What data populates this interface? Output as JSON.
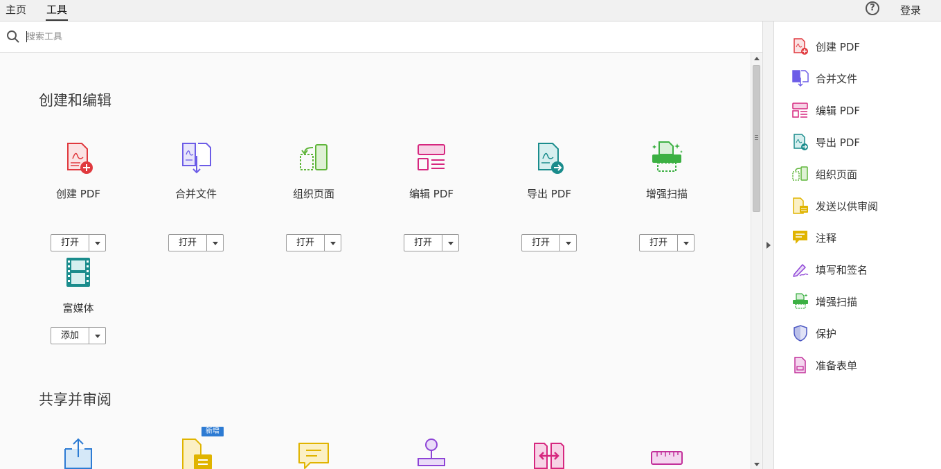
{
  "top_tabs": {
    "home": "主页",
    "tools": "工具"
  },
  "login": "登录",
  "help_icon_glyph": "?",
  "search": {
    "placeholder": "搜索工具"
  },
  "sections": {
    "create_edit": "创建和编辑",
    "share_review": "共享并审阅"
  },
  "tools": [
    {
      "label": "创建 PDF",
      "button": "打开",
      "icon": "create-pdf-icon"
    },
    {
      "label": "合并文件",
      "button": "打开",
      "icon": "combine-files-icon"
    },
    {
      "label": "组织页面",
      "button": "打开",
      "icon": "organize-pages-icon"
    },
    {
      "label": "编辑 PDF",
      "button": "打开",
      "icon": "edit-pdf-icon"
    },
    {
      "label": "导出 PDF",
      "button": "打开",
      "icon": "export-pdf-icon"
    },
    {
      "label": "增强扫描",
      "button": "打开",
      "icon": "enhance-scan-icon"
    },
    {
      "label": "富媒体",
      "button": "添加",
      "icon": "rich-media-icon"
    }
  ],
  "share_tools": [
    {
      "icon": "share-icon"
    },
    {
      "icon": "send-for-review-icon",
      "badge": "新增"
    },
    {
      "icon": "comment-icon"
    },
    {
      "icon": "stamp-icon"
    },
    {
      "icon": "compare-icon"
    },
    {
      "icon": "measure-icon"
    }
  ],
  "right_panel": [
    {
      "label": "创建 PDF",
      "icon": "create-pdf-icon",
      "color": "#e0393e"
    },
    {
      "label": "合并文件",
      "icon": "combine-files-icon",
      "color": "#6c5ce7"
    },
    {
      "label": "编辑 PDF",
      "icon": "edit-pdf-icon",
      "color": "#d6277f"
    },
    {
      "label": "导出 PDF",
      "icon": "export-pdf-icon",
      "color": "#1a8c8c"
    },
    {
      "label": "组织页面",
      "icon": "organize-pages-icon",
      "color": "#5fb53a"
    },
    {
      "label": "发送以供审阅",
      "icon": "send-for-review-icon",
      "color": "#e0b400"
    },
    {
      "label": "注释",
      "icon": "comment-icon",
      "color": "#e0b400"
    },
    {
      "label": "填写和签名",
      "icon": "fill-sign-icon",
      "color": "#8e44d6"
    },
    {
      "label": "增强扫描",
      "icon": "enhance-scan-icon",
      "color": "#3cb043"
    },
    {
      "label": "保护",
      "icon": "protect-icon",
      "color": "#4a56c2"
    },
    {
      "label": "准备表单",
      "icon": "prepare-form-icon",
      "color": "#c2309a"
    }
  ]
}
